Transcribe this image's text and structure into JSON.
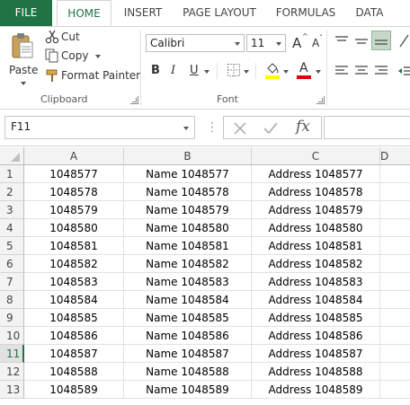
{
  "tabs": {
    "file": "FILE",
    "home": "HOME",
    "insert": "INSERT",
    "page_layout": "PAGE LAYOUT",
    "formulas": "FORMULAS",
    "data": "DATA"
  },
  "clipboard": {
    "paste": "Paste",
    "cut": "Cut",
    "copy": "Copy",
    "format_painter": "Format Painter",
    "group_label": "Clipboard"
  },
  "font": {
    "name": "Calibri",
    "size": "11",
    "grow": "A",
    "shrink": "A",
    "bold": "B",
    "italic": "I",
    "underline": "U",
    "font_color_letter": "A",
    "group_label": "Font"
  },
  "formula_bar": {
    "name_box": "F11",
    "fx": "fx",
    "value": ""
  },
  "columns": [
    "A",
    "B",
    "C",
    "D"
  ],
  "rows": [
    {
      "num": "1",
      "a": "1048577",
      "b": "Name 1048577",
      "c": "Address 1048577"
    },
    {
      "num": "2",
      "a": "1048578",
      "b": "Name 1048578",
      "c": "Address 1048578"
    },
    {
      "num": "3",
      "a": "1048579",
      "b": "Name 1048579",
      "c": "Address 1048579"
    },
    {
      "num": "4",
      "a": "1048580",
      "b": "Name 1048580",
      "c": "Address 1048580"
    },
    {
      "num": "5",
      "a": "1048581",
      "b": "Name 1048581",
      "c": "Address 1048581"
    },
    {
      "num": "6",
      "a": "1048582",
      "b": "Name 1048582",
      "c": "Address 1048582"
    },
    {
      "num": "7",
      "a": "1048583",
      "b": "Name 1048583",
      "c": "Address 1048583"
    },
    {
      "num": "8",
      "a": "1048584",
      "b": "Name 1048584",
      "c": "Address 1048584"
    },
    {
      "num": "9",
      "a": "1048585",
      "b": "Name 1048585",
      "c": "Address 1048585"
    },
    {
      "num": "10",
      "a": "1048586",
      "b": "Name 1048586",
      "c": "Address 1048586"
    },
    {
      "num": "11",
      "a": "1048587",
      "b": "Name 1048587",
      "c": "Address 1048587"
    },
    {
      "num": "12",
      "a": "1048588",
      "b": "Name 1048588",
      "c": "Address 1048588"
    },
    {
      "num": "13",
      "a": "1048589",
      "b": "Name 1048589",
      "c": "Address 1048589"
    }
  ],
  "colors": {
    "accent": "#217346",
    "font_color": "#e00000",
    "highlight": "#ffff00"
  }
}
